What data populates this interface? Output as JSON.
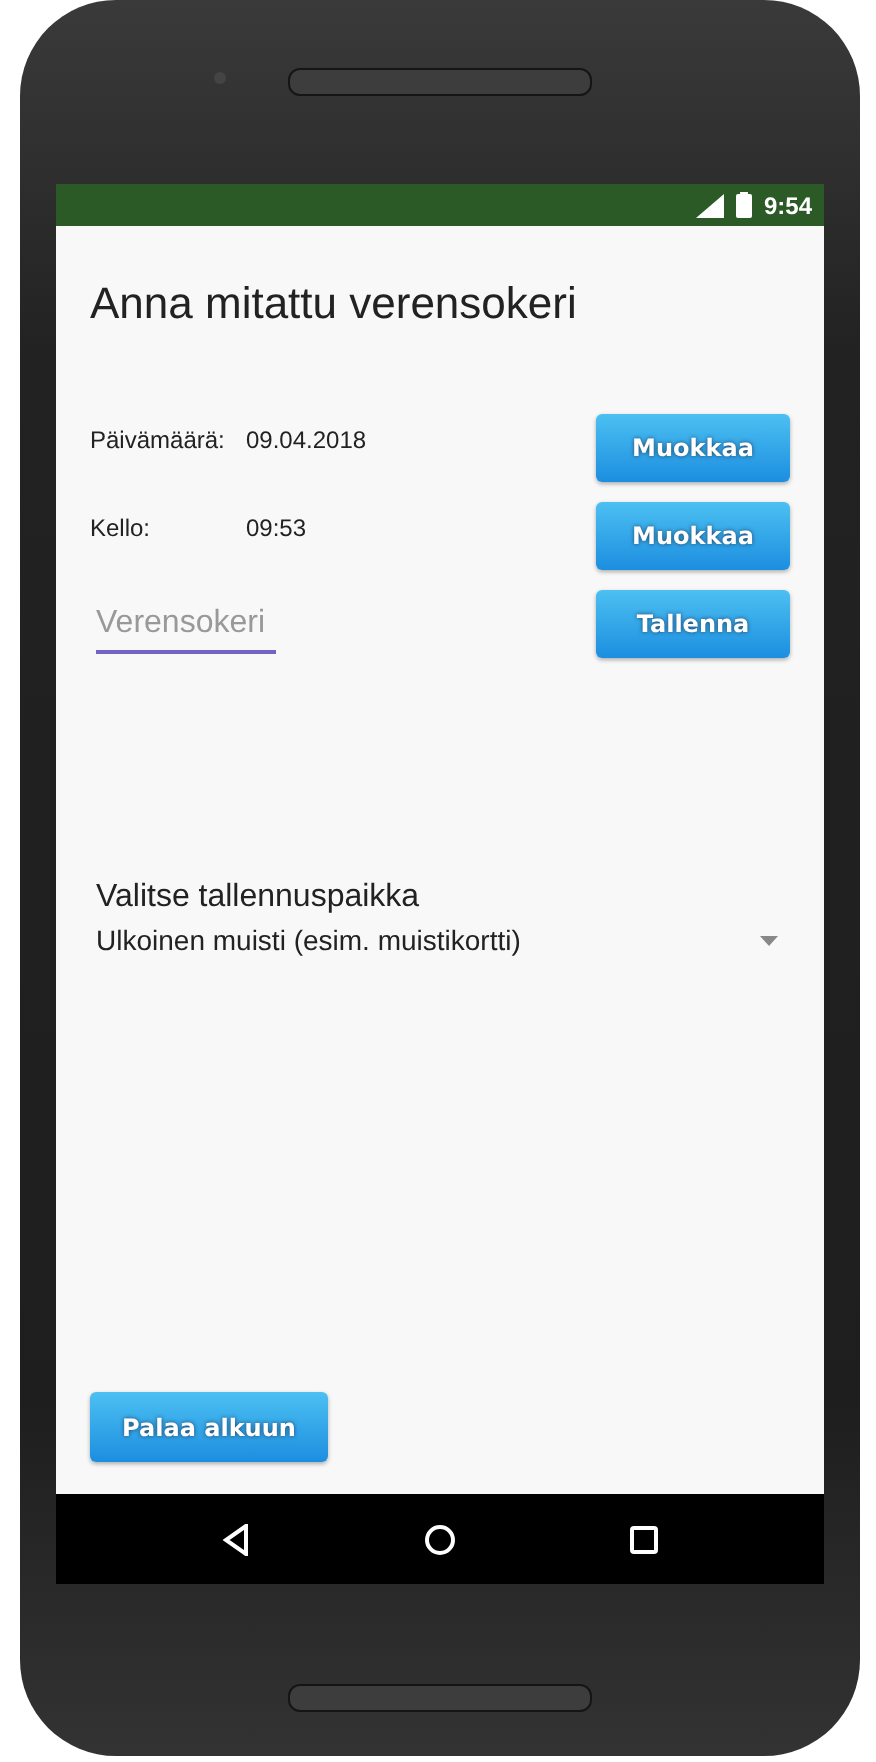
{
  "status_bar": {
    "time": "9:54"
  },
  "title": "Anna mitattu verensokeri",
  "rows": [
    {
      "label": "Päivämäärä:",
      "value": "09.04.2018",
      "button": "Muokkaa"
    },
    {
      "label": "Kello:",
      "value": "09:53",
      "button": "Muokkaa"
    }
  ],
  "glucose_field": {
    "placeholder": "Verensokeri"
  },
  "save_button": "Tallenna",
  "storage": {
    "label": "Valitse tallennuspaikka",
    "value": "Ulkoinen muisti (esim. muistikortti)"
  },
  "back_button": "Palaa alkuun"
}
